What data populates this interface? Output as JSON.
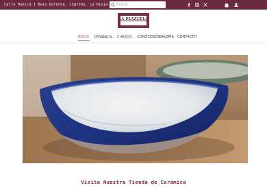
{
  "topbar": {
    "address": "Calle Huesca 1 Bajo Derecha, Logroño, La Rioja",
    "search_placeholder": "Buscar",
    "icons": [
      "search-icon",
      "facebook-icon",
      "instagram-icon",
      "x-icon",
      "cart-icon",
      "user-icon"
    ],
    "bg_color": "#6b2a3f"
  },
  "logo": {
    "text": "LA PLAZUELA"
  },
  "nav": {
    "items": [
      {
        "label": "INICIO",
        "dropdown": false,
        "active": true
      },
      {
        "label": "CERÁMICA",
        "dropdown": true
      },
      {
        "label": "CURSOS",
        "dropdown": true
      },
      {
        "label": "CONÓCENOS",
        "dropdown": false
      },
      {
        "label": "GALERÍA",
        "dropdown": false
      },
      {
        "label": "CONTACTO",
        "dropdown": false
      }
    ],
    "dropdown_glyph": "⌄",
    "active_color": "#c0506b"
  },
  "main": {
    "heading": "Visita Nuestra Tienda de Cerámica"
  }
}
